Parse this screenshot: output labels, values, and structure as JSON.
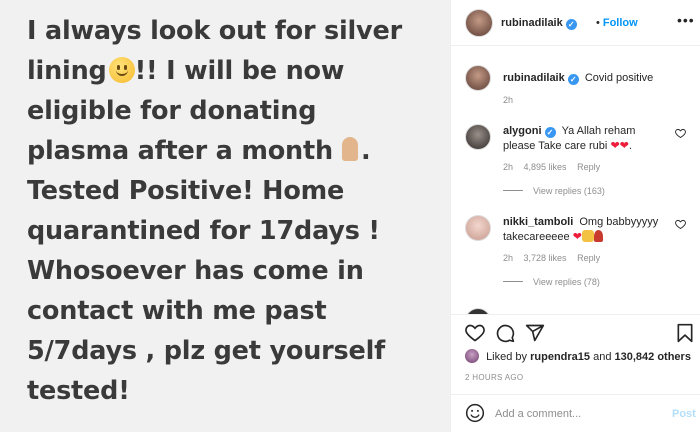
{
  "post_image": {
    "lines": [
      "I always look out for silver",
      "lining",
      "!! I will be now",
      "eligible for donating",
      "plasma after a month",
      ".",
      "Tested Positive! Home",
      "quarantined for 17days !",
      "Whosoever has come in",
      "contact with me past",
      "5/7days , plz get yourself",
      "tested!"
    ]
  },
  "header": {
    "username": "rubinadilaik",
    "verified_mark": "✓",
    "separator": "•",
    "follow_label": "Follow",
    "more_label": "•••"
  },
  "caption": {
    "username": "rubinadilaik",
    "text": "Covid positive",
    "time": "2h"
  },
  "comments": [
    {
      "username": "alygoni",
      "text": "Ya Allah reham please Take care rubi",
      "hearts": "❤❤",
      "time": "2h",
      "likes": "4,895 likes",
      "reply_label": "Reply",
      "view_replies": "View replies (163)"
    },
    {
      "username": "nikki_tamboli",
      "text": "Omg babbyyyyy takecareeeee",
      "hearts": "❤",
      "time": "2h",
      "likes": "3,728 likes",
      "reply_label": "Reply",
      "view_replies": "View replies (78)"
    }
  ],
  "likes_bar": {
    "prefix": "Liked by",
    "user": "rupendra15",
    "and": "and",
    "others": "130,842 others"
  },
  "time_ago": "2 HOURS AGO",
  "add_comment": {
    "placeholder": "Add a comment...",
    "post_label": "Post"
  },
  "icons": {
    "like": "heart-outline-icon",
    "comment": "comment-icon",
    "share": "paper-plane-icon",
    "save": "bookmark-icon",
    "emoji": "smiley-icon"
  },
  "colors": {
    "accent": "#0095f6",
    "verified": "#3897f0",
    "heart": "#ed1d3b",
    "muted": "#8e8e8e",
    "post_disabled": "#b2dffc"
  }
}
